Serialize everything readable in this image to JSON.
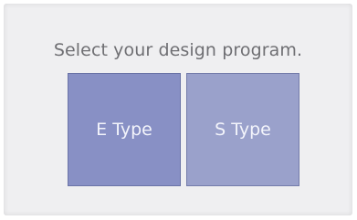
{
  "prompt": "Select your design program.",
  "options": [
    {
      "label": "E Type",
      "color": "#8890c5"
    },
    {
      "label": "S Type",
      "color": "#9aa1cb"
    }
  ],
  "colors": {
    "background": "#efeff1",
    "prompt_text": "#6f6f73",
    "button_text": "#f3f4fb"
  }
}
